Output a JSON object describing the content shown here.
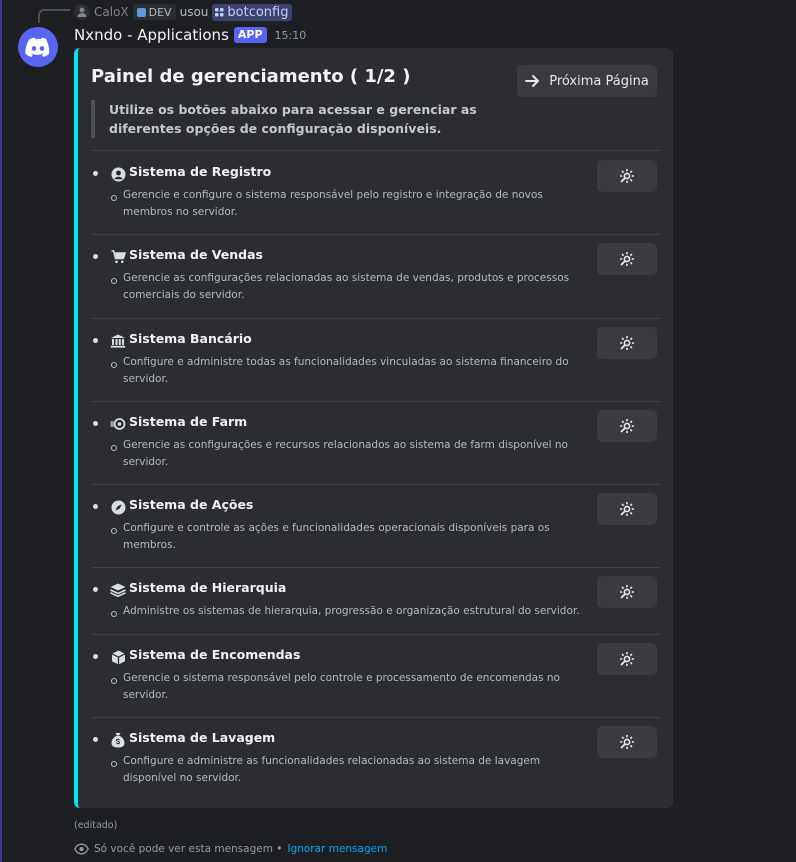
{
  "reply": {
    "user": "CaloX",
    "badge": "DEV",
    "verb": "usou",
    "command": "botconfig"
  },
  "message": {
    "author": "Nxndo - Applications",
    "app_tag": "APP",
    "time": "15:10",
    "edited": "(editado)",
    "ephemeral_text": "Só você pode ver esta mensagem •",
    "ignore_link": "Ignorar mensagem"
  },
  "panel": {
    "title": "Painel de gerenciamento ( 1/2 )",
    "next_button": "Próxima Página",
    "intro": "Utilize os botões abaixo para acessar e gerenciar as diferentes opções de configuração disponíveis.",
    "accent_color": "#00e5f0",
    "sections": [
      {
        "icon": "user-circle-icon",
        "title": "Sistema de Registro",
        "desc": "Gerencie e configure o sistema responsável pelo registro e integração de novos membros no servidor."
      },
      {
        "icon": "cart-icon",
        "title": "Sistema de Vendas",
        "desc": "Gerencie as configurações relacionadas ao sistema de vendas, produtos e processos comerciais do servidor."
      },
      {
        "icon": "bank-icon",
        "title": "Sistema Bancário",
        "desc": "Configure e administre todas as funcionalidades vinculadas ao sistema financeiro do servidor."
      },
      {
        "icon": "farm-icon",
        "title": "Sistema de Farm",
        "desc": "Gerencie as configurações e recursos relacionados ao sistema de farm disponível no servidor."
      },
      {
        "icon": "compass-icon",
        "title": "Sistema de Ações",
        "desc": "Configure e controle as ações e funcionalidades operacionais disponíveis para os membros."
      },
      {
        "icon": "layers-icon",
        "title": "Sistema de Hierarquia",
        "desc": "Administre os sistemas de hierarquia, progressão e organização estrutural do servidor."
      },
      {
        "icon": "box-icon",
        "title": "Sistema de Encomendas",
        "desc": "Gerencie o sistema responsável pelo controle e processamento de encomendas no servidor."
      },
      {
        "icon": "money-bag-icon",
        "title": "Sistema de Lavagem",
        "desc": "Configure e administre as funcionalidades relacionadas ao sistema de lavagem disponível no servidor."
      }
    ]
  }
}
